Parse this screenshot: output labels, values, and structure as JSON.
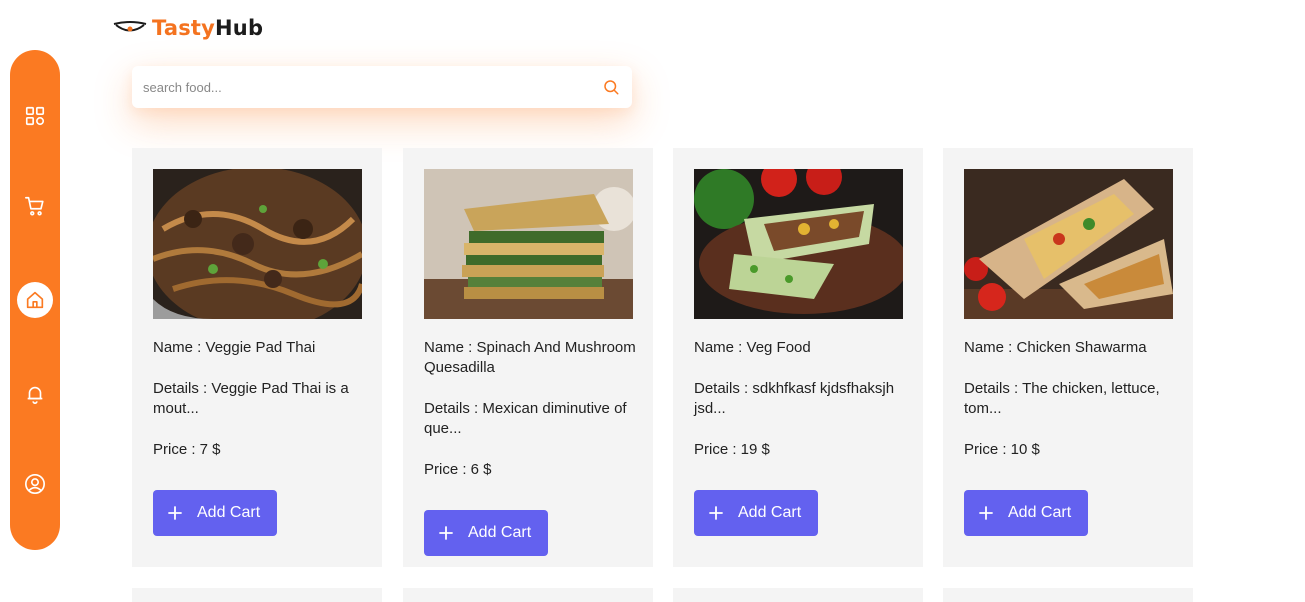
{
  "app": {
    "name_part1": "Tasty",
    "name_part2": "Hub",
    "accent": "#fb7a22",
    "button_color": "#6361ef"
  },
  "sidebar": {
    "items": [
      {
        "icon": "dashboard-grid-icon",
        "active": false
      },
      {
        "icon": "cart-icon",
        "active": false
      },
      {
        "icon": "home-icon",
        "active": true
      },
      {
        "icon": "bell-icon",
        "active": false
      },
      {
        "icon": "user-profile-icon",
        "active": false
      }
    ]
  },
  "search": {
    "placeholder": "search food...",
    "value": "",
    "icon": "search-icon"
  },
  "products": [
    {
      "name": "Name : Veggie Pad Thai",
      "details": "Details : Veggie Pad Thai is a mout...",
      "price": "Price : 7 $",
      "button": "Add Cart"
    },
    {
      "name": "Name : Spinach And Mushroom Quesadilla",
      "details": "Details : Mexican diminutive of que...",
      "price": "Price : 6 $",
      "button": "Add Cart"
    },
    {
      "name": "Name : Veg Food",
      "details": "Details : sdkhfkasf kjdsfhaksjh jsd...",
      "price": "Price : 19 $",
      "button": "Add Cart"
    },
    {
      "name": "Name : Chicken Shawarma",
      "details": "Details : The chicken, lettuce, tom...",
      "price": "Price : 10 $",
      "button": "Add Cart"
    }
  ]
}
